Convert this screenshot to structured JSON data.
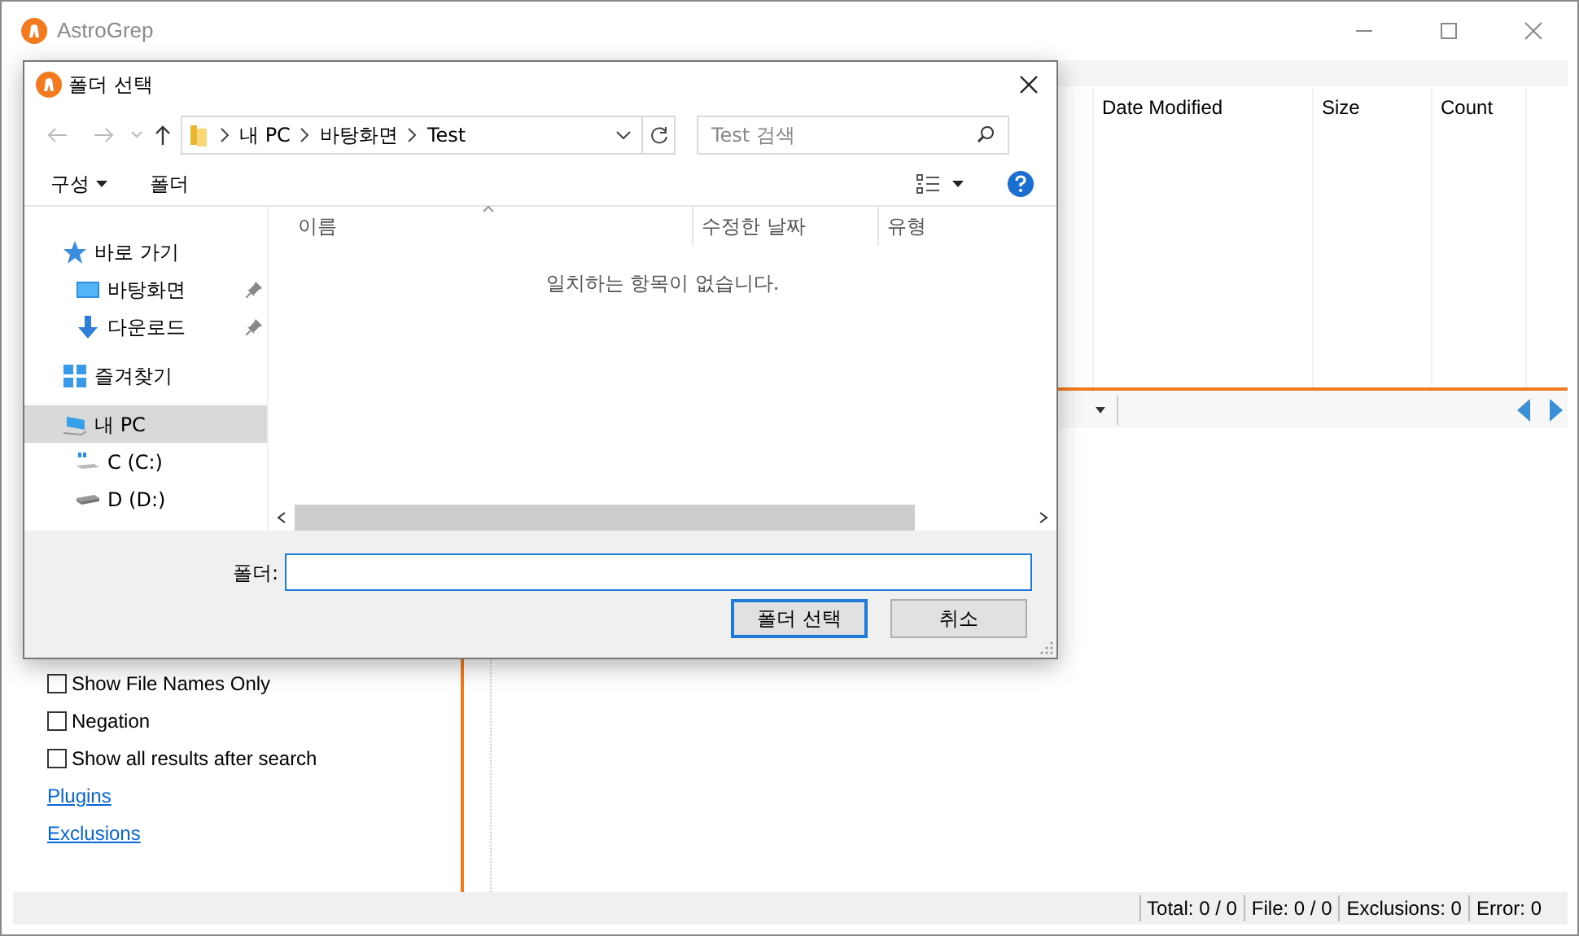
{
  "app": {
    "title": "AstroGrep",
    "columns": [
      {
        "label": "Date Modified"
      },
      {
        "label": "Size"
      },
      {
        "label": "Count"
      }
    ],
    "options": [
      {
        "label": "Show File Names Only",
        "checked": false
      },
      {
        "label": "Negation",
        "checked": false
      },
      {
        "label": "Show all results after search",
        "checked": false
      }
    ],
    "links": [
      "Plugins",
      "Exclusions"
    ],
    "status": [
      "Total: 0 / 0",
      "File: 0 / 0",
      "Exclusions: 0",
      "Error: 0"
    ]
  },
  "dialog": {
    "title": "폴더 선택",
    "breadcrumb": [
      "내 PC",
      "바탕화면",
      "Test"
    ],
    "search_placeholder": "Test 검색",
    "toolbar": [
      "구성",
      "폴더"
    ],
    "nav": [
      {
        "label": "바로 가기",
        "kind": "star",
        "selected": false,
        "children": [
          {
            "label": "바탕화면",
            "kind": "desktop",
            "selected": false,
            "pinned": true
          },
          {
            "label": "다운로드",
            "kind": "download",
            "selected": false,
            "pinned": true
          }
        ]
      },
      {
        "label": "즐겨찾기",
        "kind": "grid",
        "selected": false
      },
      {
        "label": "내 PC",
        "kind": "pc",
        "selected": true,
        "children": [
          {
            "label": "C (C:)",
            "kind": "cdrive",
            "selected": false
          },
          {
            "label": "D (D:)",
            "kind": "drive",
            "selected": false
          }
        ]
      }
    ],
    "columns": [
      "이름",
      "수정한 날짜",
      "유형"
    ],
    "empty_message": "일치하는 항목이 없습니다.",
    "folder_label": "폴더:",
    "buttons": [
      {
        "label": "폴더 선택",
        "kind": "primary"
      },
      {
        "label": "취소",
        "kind": "secondary"
      }
    ]
  }
}
